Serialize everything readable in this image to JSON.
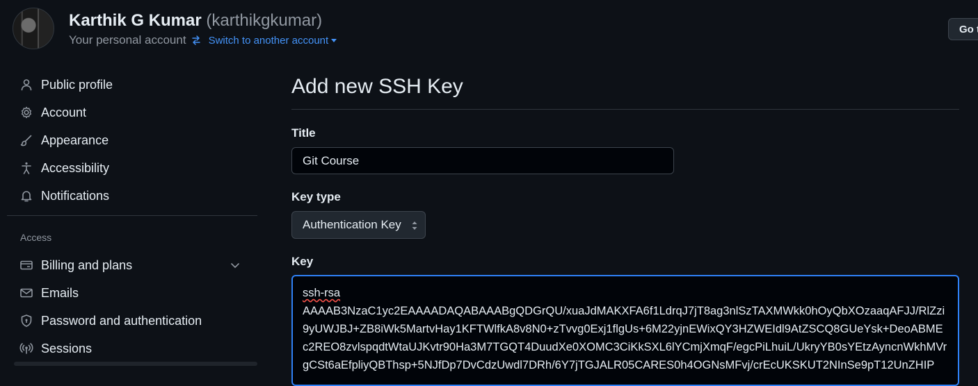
{
  "account": {
    "name": "Karthik G Kumar",
    "login": "(karthikgkumar)",
    "subtitle": "Your personal account",
    "switch_label": "Switch to another account"
  },
  "header": {
    "goto_button": "Go to"
  },
  "sidebar": {
    "items": [
      {
        "label": "Public profile",
        "icon": "person-icon"
      },
      {
        "label": "Account",
        "icon": "gear-icon"
      },
      {
        "label": "Appearance",
        "icon": "paintbrush-icon"
      },
      {
        "label": "Accessibility",
        "icon": "accessibility-icon"
      },
      {
        "label": "Notifications",
        "icon": "bell-icon"
      }
    ],
    "section_access": "Access",
    "access_items": [
      {
        "label": "Billing and plans",
        "icon": "credit-card-icon"
      },
      {
        "label": "Emails",
        "icon": "mail-icon"
      },
      {
        "label": "Password and authentication",
        "icon": "shield-lock-icon"
      },
      {
        "label": "Sessions",
        "icon": "broadcast-icon"
      }
    ]
  },
  "form": {
    "page_title": "Add new SSH Key",
    "title_label": "Title",
    "title_value": "Git Course",
    "key_type_label": "Key type",
    "key_type_value": "Authentication Key",
    "key_label": "Key",
    "key_prefix": "ssh-rsa",
    "key_body": "AAAAB3NzaC1yc2EAAAADAQABAAABgQDGrQU/xuaJdMAKXFA6f1LdrqJ7jT8ag3nlSzTAXMWkk0hOyQbXOzaaqAFJJ/RlZzi9yUWJBJ+ZB8iWk5MartvHay1KFTWlfkA8v8N0+zTvvg0Exj1flgUs+6M22yjnEWixQY3HZWEIdl9AtZSCQ8GUeYsk+DeoABMEc2REO8zvlspqdtWtaUJKvtr90Ha3M7TGQT4DuudXe0XOMC3CiKkSXL6lYCmjXmqF/egcPiLhuiL/UkryYB0sYEtzAyncnWkhMVrgCSt6aEfpliyQBThsp+5NJfDp7DvCdzUwdl7DRh/6Y7jTGJALR05CARES0h4OGNsMFvj/crEcUKSKUT2NInSe9pT12UnZHIP"
  },
  "colors": {
    "background": "#0d1117",
    "link": "#4493f8",
    "focus_border": "#2f81f7",
    "muted": "#9198a1"
  }
}
